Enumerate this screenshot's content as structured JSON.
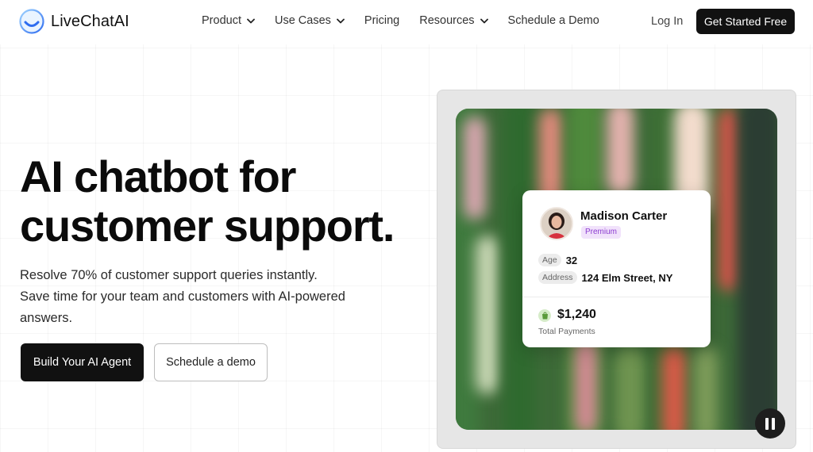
{
  "header": {
    "brand": "LiveChatAI",
    "nav": [
      {
        "label": "Product",
        "dropdown": true
      },
      {
        "label": "Use Cases",
        "dropdown": true
      },
      {
        "label": "Pricing",
        "dropdown": false
      },
      {
        "label": "Resources",
        "dropdown": true
      },
      {
        "label": "Schedule a Demo",
        "dropdown": false
      }
    ],
    "login": "Log In",
    "cta": "Get Started Free"
  },
  "hero": {
    "title_line1": "AI chatbot for",
    "title_line2": "customer support.",
    "subtitle_line1": "Resolve 70% of customer support queries instantly.",
    "subtitle_line2": "Save time for your team and customers with AI-powered answers.",
    "primary_button": "Build Your AI Agent",
    "secondary_button": "Schedule a demo"
  },
  "customer_card": {
    "name": "Madison Carter",
    "tier": "Premium",
    "age_label": "Age",
    "age": "32",
    "address_label": "Address",
    "address": "124 Elm Street, NY",
    "total": "$1,240",
    "total_label": "Total Payments"
  },
  "icons": {
    "logo": "smile-logo-icon",
    "nav_chevron": "chevron-down-icon",
    "payment": "shopping-bag-icon",
    "video_control": "pause-icon"
  },
  "colors": {
    "primary": "#111111",
    "premium_badge_bg": "#f1e2fb",
    "premium_badge_text": "#8b3bd0",
    "logo_blue": "#2f7df6"
  }
}
